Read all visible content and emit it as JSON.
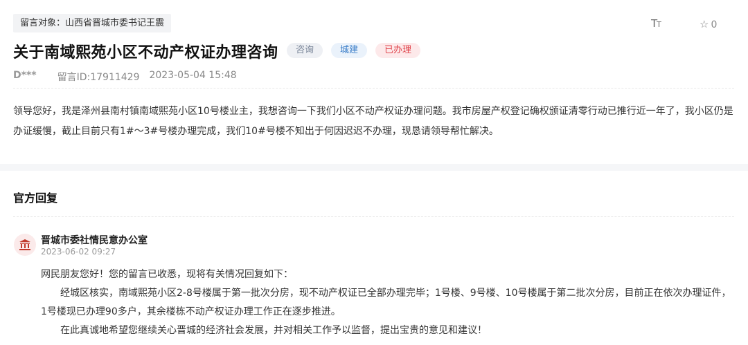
{
  "message": {
    "target_label": "留言对象：",
    "target_value": "山西省晋城市委书记王震",
    "title": "关于南域熙苑小区不动产权证办理咨询",
    "badges": [
      "咨询",
      "城建",
      "已办理"
    ],
    "author": "D***",
    "message_id": "留言ID:17911429",
    "datetime": "2023-05-04 15:48",
    "content": "领导您好，我是泽州县南村镇南域熙苑小区10号楼业主，我想咨询一下我们小区不动产权证办理问题。我市房屋产权登记确权颁证清零行动已推行近一年了，我小区仍是办证缓慢，截止目前只有1#～3#号楼办理完成，我们10#号楼不知出于何因迟迟不办理，现恳请领导帮忙解决。"
  },
  "toolbar": {
    "font_size_glyph": "T",
    "font_size_glyph_small": "T",
    "favorite_count": "0"
  },
  "reply": {
    "section_title": "官方回复",
    "org_name": "晋城市委社情民意办公室",
    "org_time": "2023-06-02 09:27",
    "greeting": "网民朋友您好！您的留言已收悉，现将有关情况回复如下：",
    "para1": "经城区核实，南域熙苑小区2-8号楼属于第一批次分房，现不动产权证已全部办理完毕；1号楼、9号楼、10号楼属于第二批次分房，目前正在依次办理证件，1号楼现已办理90多户，其余楼栋不动产权证办理工作正在逐步推进。",
    "para2": "在此真诚地希望您继续关心晋城的经济社会发展，并对相关工作予以监督，提出宝贵的意见和建议！"
  },
  "colors": {
    "badge_gray": "#7a8699",
    "badge_blue": "#3d7fc9",
    "badge_red": "#e0474e",
    "org_icon": "#c0392b"
  }
}
